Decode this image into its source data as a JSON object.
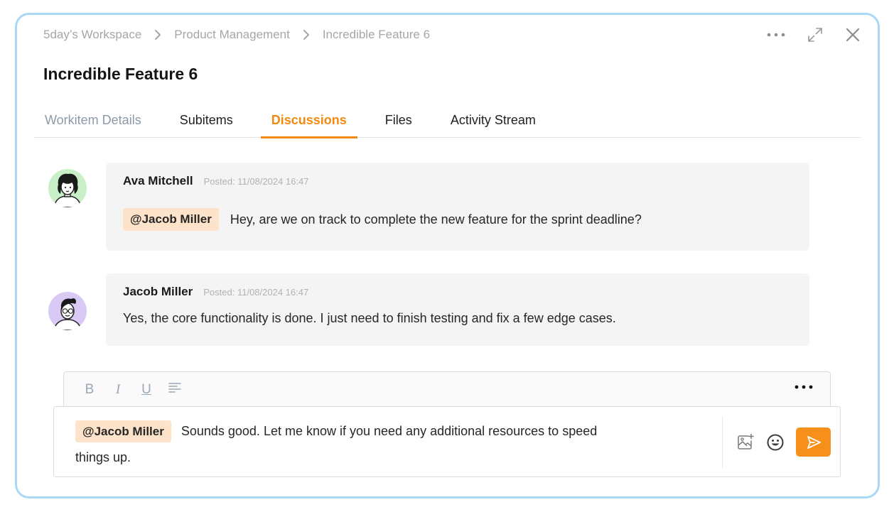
{
  "breadcrumb": [
    "5day’s Workspace",
    "Product Management",
    "Incredible Feature 6"
  ],
  "title": "Incredible Feature 6",
  "tabs": [
    {
      "label": "Workitem Details",
      "active": false
    },
    {
      "label": "Subitems",
      "active": false
    },
    {
      "label": "Discussions",
      "active": true
    },
    {
      "label": "Files",
      "active": false
    },
    {
      "label": "Activity Stream",
      "active": false
    }
  ],
  "comments": [
    {
      "author": "Ava Mitchell",
      "posted": "Posted: 11/08/2024 16:47",
      "mention": "@Jacob Miller",
      "text": "Hey, are we on track to complete the new feature for the sprint deadline?"
    },
    {
      "author": "Jacob Miller",
      "posted": "Posted: 11/08/2024 16:47",
      "text": "Yes, the core functionality is done. I just need to finish testing and fix a few edge cases."
    }
  ],
  "editor": {
    "toolbar": {
      "bold": "B",
      "italic": "I",
      "underline": "U"
    },
    "mention": "@Jacob Miller",
    "text": "Sounds good. Let me know if you need any additional resources to speed things up."
  },
  "icons": {
    "more": "more-horizontal-icon",
    "expand": "expand-icon",
    "close": "close-icon",
    "image": "add-image-icon",
    "emoji": "emoji-icon",
    "send": "send-icon"
  },
  "colors": {
    "accent": "#f28a12",
    "mention_bg": "#fde3c9",
    "border": "#a9d8f5",
    "send": "#f7901a"
  }
}
